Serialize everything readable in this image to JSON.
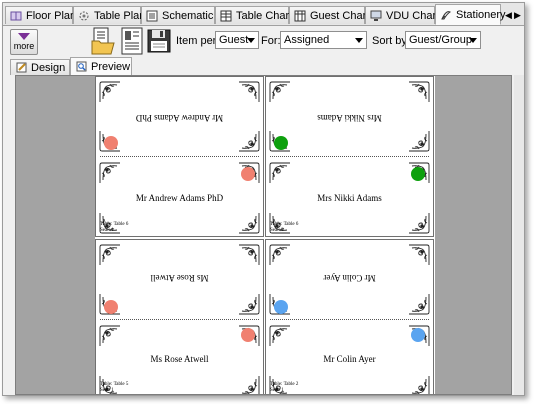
{
  "tabs": [
    {
      "label": "Floor Plan",
      "icon": "floor-plan-icon",
      "active": false
    },
    {
      "label": "Table Plan",
      "icon": "table-plan-icon",
      "active": false
    },
    {
      "label": "Schematic",
      "icon": "schematic-icon",
      "active": false
    },
    {
      "label": "Table Chart",
      "icon": "table-chart-icon",
      "active": false
    },
    {
      "label": "Guest Chart",
      "icon": "guest-chart-icon",
      "active": false
    },
    {
      "label": "VDU Chart",
      "icon": "vdu-chart-icon",
      "active": false
    },
    {
      "label": "Stationery",
      "icon": "stationery-icon",
      "active": true
    }
  ],
  "toolbar": {
    "more_label": "more",
    "item_per_label": "Item per:",
    "item_per_value": "Guest",
    "for_label": "For:",
    "for_value": "Assigned",
    "sort_by_label": "Sort by:",
    "sort_by_value": "Guest/Group"
  },
  "subtabs": [
    {
      "label": "Design",
      "icon": "pencil-icon",
      "active": false
    },
    {
      "label": "Preview",
      "icon": "magnifier-icon",
      "active": true
    }
  ],
  "colors": {
    "salmon": "#f08070",
    "green": "#0ea00e",
    "blue": "#5aa4f0"
  },
  "cards": [
    {
      "name": "Mr Andrew Adams PhD",
      "table": "Table: Table 6",
      "seat": "Seat: 1",
      "color": "salmon"
    },
    {
      "name": "Mrs Nikki Adams",
      "table": "Table: Table 6",
      "seat": "Seat: 2",
      "color": "green"
    },
    {
      "name": "Ms Rose Atwell",
      "table": "Table: Table 5",
      "seat": "Seat: 1",
      "color": "salmon"
    },
    {
      "name": "Mr Colin Ayer",
      "table": "Table: Table 2",
      "seat": "Seat: 1",
      "color": "blue"
    }
  ]
}
